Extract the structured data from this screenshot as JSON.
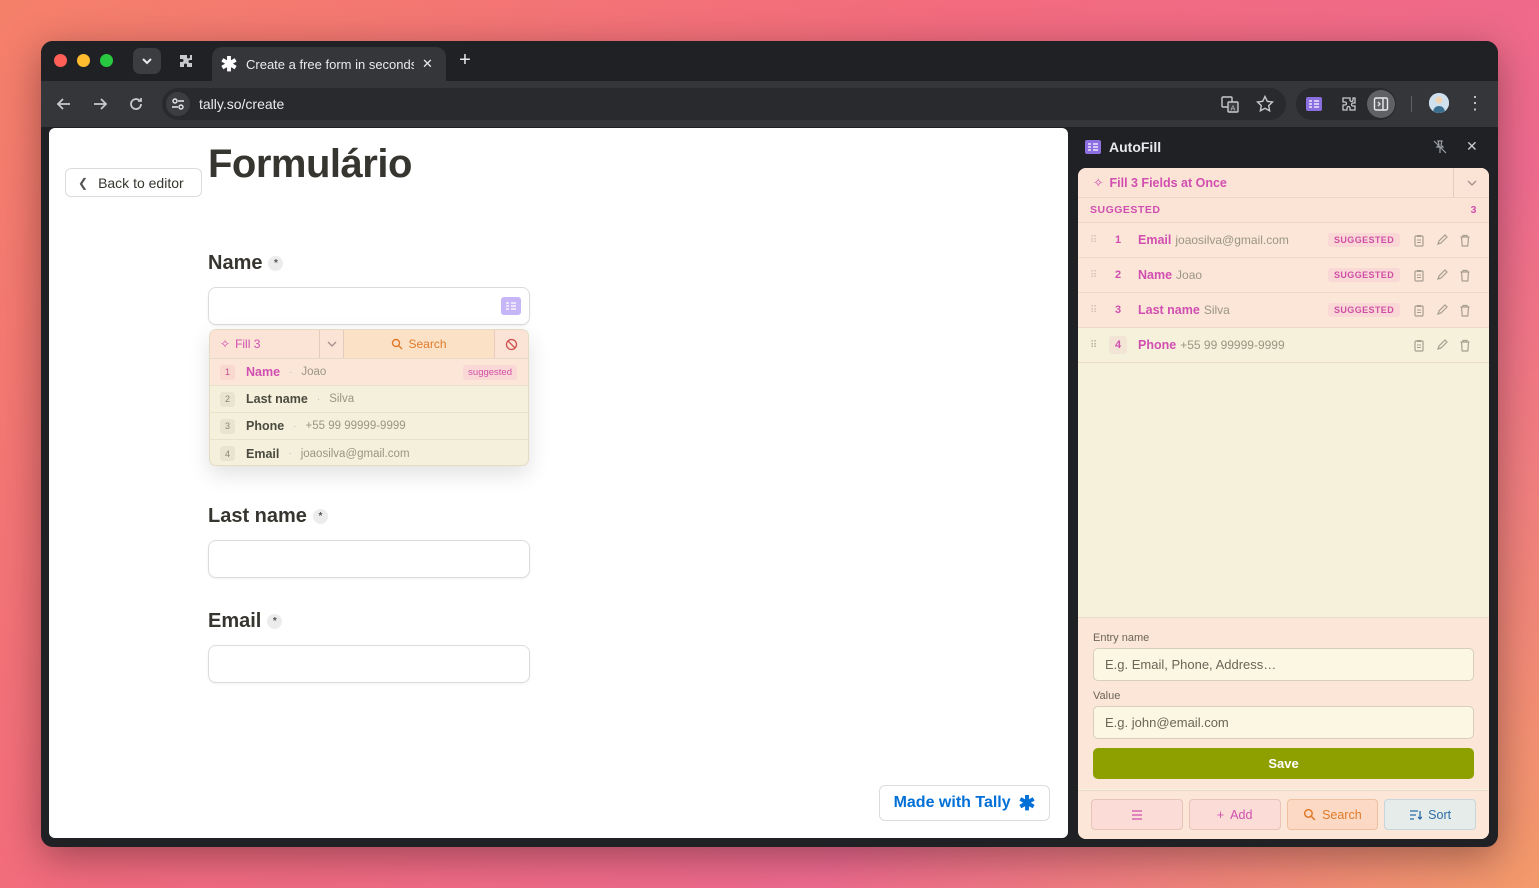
{
  "browser": {
    "tab_title": "Create a free form in seconds",
    "url": "tally.so/create"
  },
  "page": {
    "back_label": "Back to editor",
    "form_title": "Formulário",
    "fields": [
      {
        "label": "Name",
        "required": "*"
      },
      {
        "label": "Last name",
        "required": "*"
      },
      {
        "label": "Email",
        "required": "*"
      }
    ],
    "made_with": "Made with Tally"
  },
  "dropdown": {
    "fill_label": "Fill 3",
    "search_label": "Search",
    "items": [
      {
        "num": "1",
        "name": "Name",
        "value": "Joao",
        "badge": "suggested"
      },
      {
        "num": "2",
        "name": "Last name",
        "value": "Silva"
      },
      {
        "num": "3",
        "name": "Phone",
        "value": "+55 99 99999-9999"
      },
      {
        "num": "4",
        "name": "Email",
        "value": "joaosilva@gmail.com"
      }
    ]
  },
  "panel": {
    "title": "AutoFill",
    "fill_all_label": "Fill 3 Fields at Once",
    "suggested_heading": "SUGGESTED",
    "suggested_count": "3",
    "entries": [
      {
        "num": "1",
        "name": "Email",
        "value": "joaosilva@gmail.com",
        "badge": "SUGGESTED"
      },
      {
        "num": "2",
        "name": "Name",
        "value": "Joao",
        "badge": "SUGGESTED"
      },
      {
        "num": "3",
        "name": "Last name",
        "value": "Silva",
        "badge": "SUGGESTED"
      },
      {
        "num": "4",
        "name": "Phone",
        "value": "+55 99 99999-9999"
      }
    ],
    "entry_name_label": "Entry name",
    "entry_name_placeholder": "E.g. Email, Phone, Address…",
    "value_label": "Value",
    "value_placeholder": "E.g. john@email.com",
    "save_label": "Save",
    "add_label": "Add",
    "search_label": "Search",
    "sort_label": "Sort"
  },
  "colors": {
    "accent_pink": "#d14fb0",
    "save_green": "#8da000",
    "tally_blue": "#0070d7"
  }
}
